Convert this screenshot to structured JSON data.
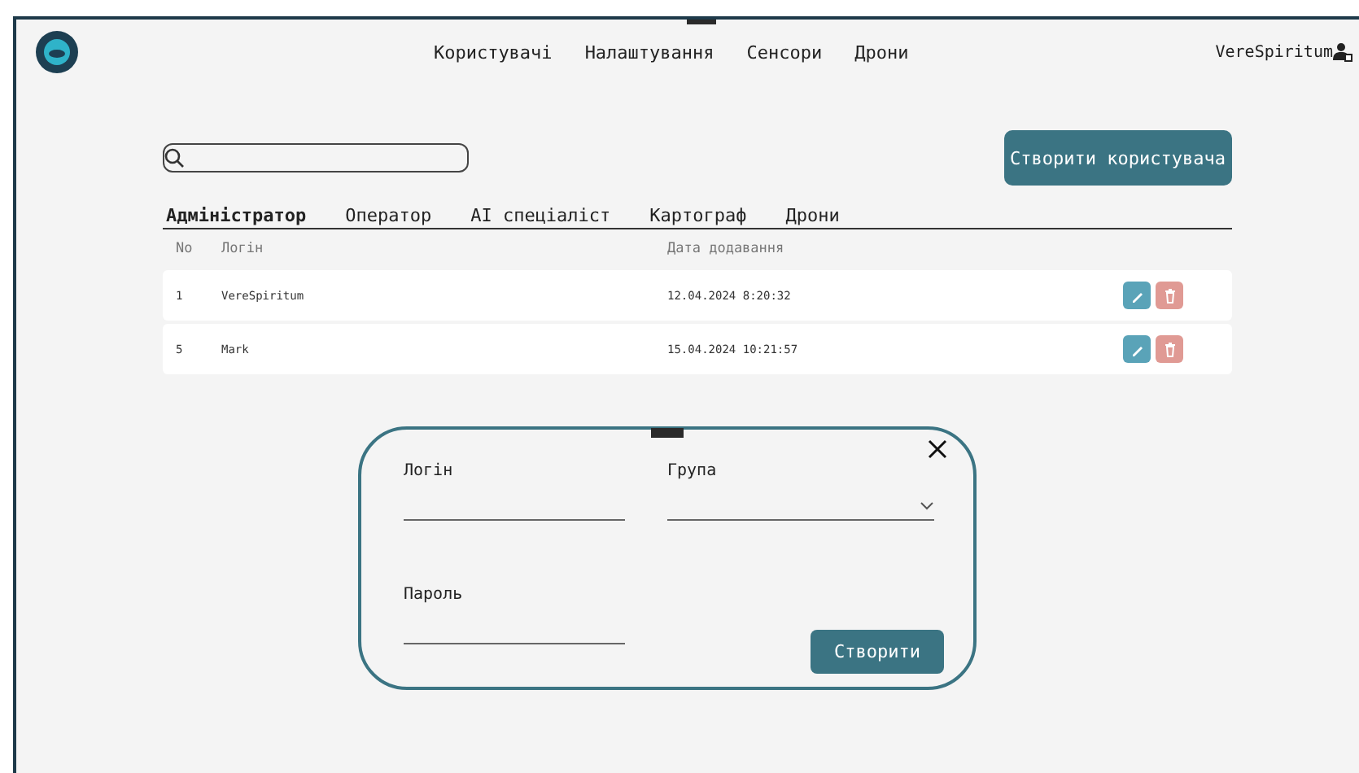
{
  "nav": {
    "items": [
      "Користувачі",
      "Налаштування",
      "Сенсори",
      "Дрони"
    ],
    "user": "VereSpiritum"
  },
  "toolbar": {
    "create_button": "Створити користувача"
  },
  "tabs": [
    {
      "label": "Адміністратор",
      "selected": true
    },
    {
      "label": "Оператор",
      "selected": false
    },
    {
      "label": "AI спеціаліст",
      "selected": false
    },
    {
      "label": "Картограф",
      "selected": false
    },
    {
      "label": "Дрони",
      "selected": false
    }
  ],
  "table": {
    "columns": [
      "No",
      "Логін",
      "Дата додавання"
    ],
    "rows": [
      {
        "no": "1",
        "login": "VereSpiritum",
        "date": "12.04.2024 8:20:32"
      },
      {
        "no": "5",
        "login": "Mark",
        "date": "15.04.2024 10:21:57"
      }
    ]
  },
  "dialog": {
    "fields": [
      {
        "label": "Логін",
        "kind": "text"
      },
      {
        "label": "Група",
        "kind": "select"
      },
      {
        "label": "Пароль",
        "kind": "text"
      }
    ],
    "submit": "Створити"
  }
}
